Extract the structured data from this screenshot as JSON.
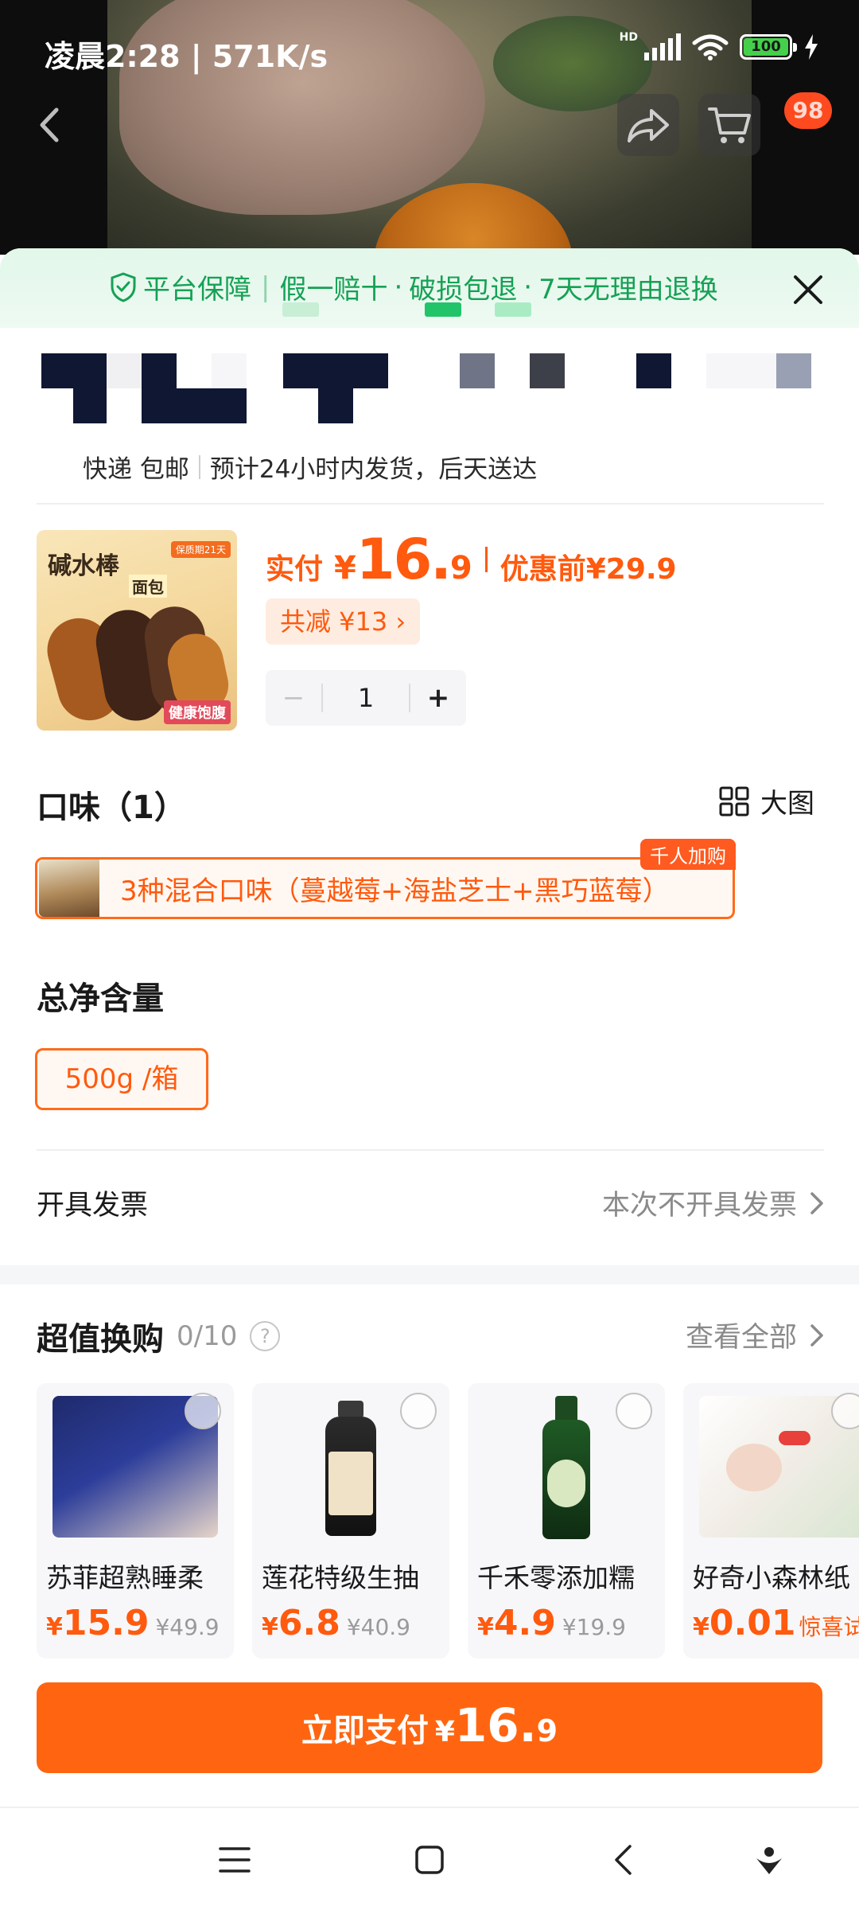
{
  "status_bar": {
    "time": "凌晨2:28 | 571K/s",
    "network": "HD",
    "battery": "100"
  },
  "header": {
    "cart_badge": "98",
    "icons": [
      "back-icon",
      "share-icon",
      "cart-icon"
    ]
  },
  "guarantee": {
    "label": "平台保障",
    "items": [
      "假一赔十",
      "破损包退",
      "7天无理由退换"
    ]
  },
  "shipping": {
    "method": "快递 包邮",
    "estimate": "预计24小时内发货，后天送达"
  },
  "product": {
    "image_text_main": "碱水棒",
    "image_text_sub": "面包",
    "image_tag": "保质期21天",
    "image_footer": "健康饱腹",
    "pay_label": "实付",
    "currency": "¥",
    "price_int": "16.",
    "price_dec": "9",
    "before_label": "优惠前",
    "before_price": "¥29.9",
    "discount": "共减 ¥13 ›",
    "quantity": "1",
    "minus": "−",
    "plus": "+"
  },
  "flavor": {
    "title": "口味（1）",
    "big_pic_label": "大图",
    "option": "3种混合口味（蔓越莓+海盐芝士+黑巧蓝莓）",
    "ribbon": "千人加购"
  },
  "weight": {
    "title": "总净含量",
    "option": "500g /箱"
  },
  "invoice": {
    "label": "开具发票",
    "value": "本次不开具发票"
  },
  "deals": {
    "title": "超值换购",
    "count": "0/10",
    "help": "?",
    "see_all": "查看全部",
    "items": [
      {
        "name": "苏菲超熟睡柔",
        "currency": "¥",
        "price": "15.9",
        "orig": "¥49.9",
        "note": ""
      },
      {
        "name": "莲花特级生抽",
        "currency": "¥",
        "price": "6.8",
        "orig": "¥40.9",
        "note": ""
      },
      {
        "name": "千禾零添加糯",
        "currency": "¥",
        "price": "4.9",
        "orig": "¥19.9",
        "note": ""
      },
      {
        "name": "好奇小森林纸",
        "currency": "¥",
        "price": "0.01",
        "orig": "",
        "note": "惊喜试用"
      }
    ]
  },
  "pay_button": {
    "label": "立即支付",
    "currency": "¥",
    "price_int": "16.",
    "price_dec": "9"
  },
  "colors": {
    "accent": "#ff6510",
    "guarantee_green": "#16a155",
    "guarantee_bg": "#e2f7ea"
  }
}
